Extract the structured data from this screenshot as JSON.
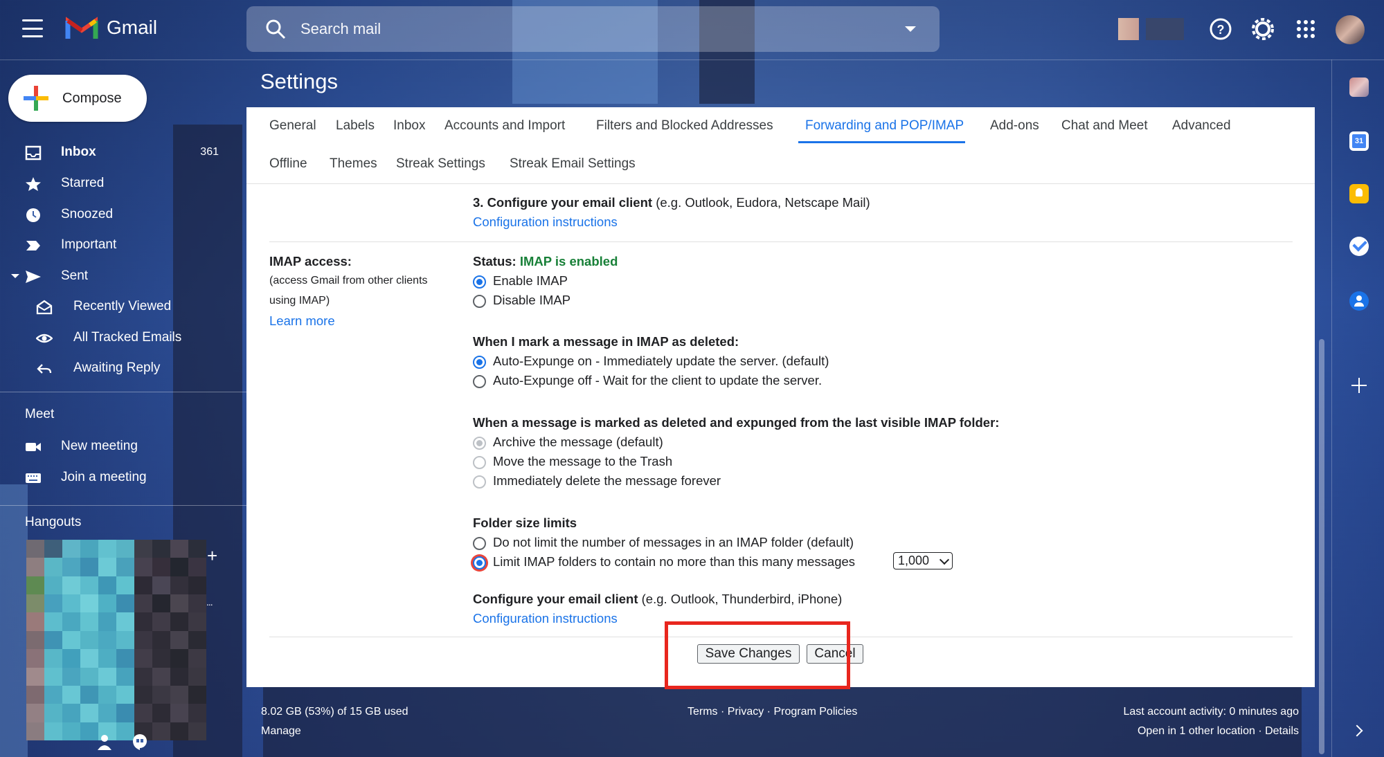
{
  "app": {
    "title": "Gmail"
  },
  "search": {
    "placeholder": "Search mail"
  },
  "compose": {
    "label": "Compose"
  },
  "sidebar": {
    "items": [
      {
        "label": "Inbox",
        "count": "361",
        "icon": "inbox-icon"
      },
      {
        "label": "Starred",
        "icon": "star-icon"
      },
      {
        "label": "Snoozed",
        "icon": "clock-icon"
      },
      {
        "label": "Important",
        "icon": "important-icon"
      },
      {
        "label": "Sent",
        "icon": "send-icon"
      },
      {
        "label": "Recently Viewed",
        "icon": "envelope-open-icon"
      },
      {
        "label": "All Tracked Emails",
        "icon": "eye-icon"
      },
      {
        "label": "Awaiting Reply",
        "icon": "reply-icon"
      }
    ],
    "meet": {
      "title": "Meet",
      "new_meeting": "New meeting",
      "join_meeting": "Join a meeting"
    },
    "hangouts": {
      "title": "Hangouts"
    }
  },
  "settings": {
    "title": "Settings",
    "tabs": [
      "General",
      "Labels",
      "Inbox",
      "Accounts and Import",
      "Filters and Blocked Addresses",
      "Forwarding and POP/IMAP",
      "Add-ons",
      "Chat and Meet",
      "Advanced",
      "Offline",
      "Themes",
      "Streak Settings",
      "Streak Email Settings"
    ],
    "active_tab": "Forwarding and POP/IMAP",
    "pop_step3": {
      "heading": "3. Configure your email client",
      "hint": "(e.g. Outlook, Eudora, Netscape Mail)",
      "link": "Configuration instructions"
    },
    "imap": {
      "label": "IMAP access:",
      "desc_line1": "(access Gmail from other clients",
      "desc_line2": "using IMAP)",
      "learn_more": "Learn more",
      "status_label": "Status:",
      "status_value": "IMAP is enabled",
      "enable": "Enable IMAP",
      "disable": "Disable IMAP",
      "deleted_heading": "When I mark a message in IMAP as deleted:",
      "expunge_on": "Auto-Expunge on - Immediately update the server. (default)",
      "expunge_off": "Auto-Expunge off - Wait for the client to update the server.",
      "expunged_heading": "When a message is marked as deleted and expunged from the last visible IMAP folder:",
      "archive": "Archive the message (default)",
      "trash": "Move the message to the Trash",
      "delete_forever": "Immediately delete the message forever",
      "folder_heading": "Folder size limits",
      "no_limit": "Do not limit the number of messages in an IMAP folder (default)",
      "limit": "Limit IMAP folders to contain no more than this many messages",
      "limit_value": "1,000",
      "client_heading": "Configure your email client",
      "client_hint": "(e.g. Outlook, Thunderbird, iPhone)",
      "client_link": "Configuration instructions"
    },
    "buttons": {
      "save": "Save Changes",
      "cancel": "Cancel"
    }
  },
  "footer": {
    "storage": "8.02 GB (53%) of 15 GB used",
    "manage": "Manage",
    "links": "Terms · Privacy · Program Policies",
    "activity": "Last account activity: 0 minutes ago",
    "location": "Open in 1 other location · Details"
  },
  "colors": {
    "accent": "#1a73e8",
    "enabled": "#188038",
    "highlight": "#e8261e"
  }
}
